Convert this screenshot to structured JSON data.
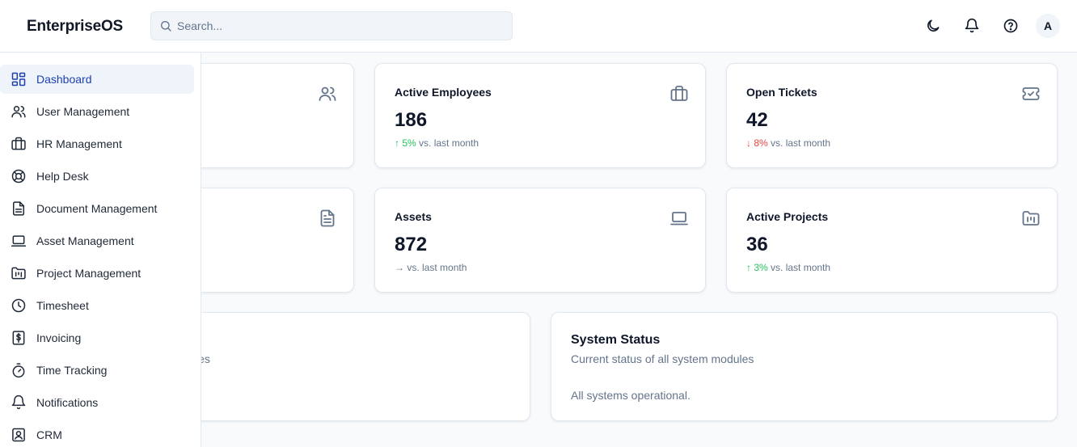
{
  "app": {
    "brand": "EnterpriseOS"
  },
  "search": {
    "placeholder": "Search..."
  },
  "topbar": {
    "icons": [
      "moon-icon",
      "bell-icon",
      "help-circle-icon"
    ],
    "avatar_initial": "A"
  },
  "sidebar": {
    "items": [
      {
        "label": "Dashboard",
        "icon": "layout-dashboard-icon",
        "active": true
      },
      {
        "label": "User Management",
        "icon": "users-icon"
      },
      {
        "label": "HR Management",
        "icon": "briefcase-icon"
      },
      {
        "label": "Help Desk",
        "icon": "life-buoy-icon"
      },
      {
        "label": "Document Management",
        "icon": "file-text-icon"
      },
      {
        "label": "Asset Management",
        "icon": "laptop-icon"
      },
      {
        "label": "Project Management",
        "icon": "folder-kanban-icon"
      },
      {
        "label": "Timesheet",
        "icon": "clock-icon"
      },
      {
        "label": "Invoicing",
        "icon": "receipt-dollar-icon"
      },
      {
        "label": "Time Tracking",
        "icon": "timer-icon"
      },
      {
        "label": "Notifications",
        "icon": "bell-icon"
      },
      {
        "label": "CRM",
        "icon": "contact-icon"
      }
    ]
  },
  "cards": {
    "active_employees": {
      "title": "Active Employees",
      "value": "186",
      "trend_arrow": "↑ 5%",
      "trend_text": "vs. last month",
      "trend": "up",
      "icon": "briefcase-icon"
    },
    "open_tickets": {
      "title": "Open Tickets",
      "value": "42",
      "trend_arrow": "↓ 8%",
      "trend_text": "vs. last month",
      "trend": "down",
      "icon": "ticket-icon"
    },
    "assets": {
      "title": "Assets",
      "value": "872",
      "trend_arrow": "→",
      "trend_text": "vs. last month",
      "trend": "neutral",
      "icon": "laptop-icon"
    },
    "active_projects": {
      "title": "Active Projects",
      "value": "36",
      "trend_arrow": "↑ 3%",
      "trend_text": "vs. last month",
      "trend": "up",
      "icon": "folder-kanban-icon"
    }
  },
  "partial_card": {
    "sub_fragment": "les",
    "icon_top": "users-icon",
    "icon_mid": "file-text-icon"
  },
  "system_status": {
    "title": "System Status",
    "subtitle": "Current status of all system modules",
    "body": "All systems operational."
  },
  "colors": {
    "accent": "#1e40af",
    "active_bg": "#eff4fb",
    "up": "#22c55e",
    "down": "#ef4444"
  }
}
